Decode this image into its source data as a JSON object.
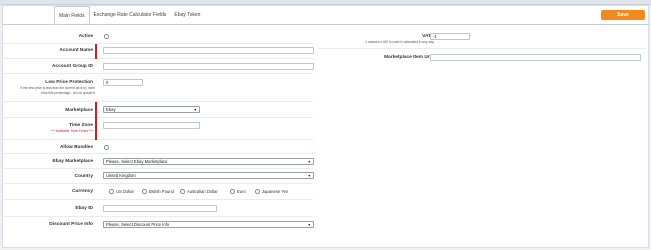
{
  "tabs": [
    {
      "label": "Main Fields",
      "active": true
    },
    {
      "label": "Exchange Rate Calculator Fields",
      "active": false
    },
    {
      "label": "Ebay Token",
      "active": false
    }
  ],
  "save_label": "Save",
  "accent_color": "#f08a1c",
  "required_color": "#d7191c",
  "left": {
    "active_label": "Active",
    "account_name_label": "Account Name",
    "account_name_value": "",
    "account_group_label": "Account Group ID",
    "account_group_value": "",
    "low_price_label": "Low Price Protection",
    "low_price_value": "0",
    "low_price_help_1": "If the new price is less than the current price by more",
    "low_price_help_2": "than this percentage - do not update it",
    "marketplace_label": "Marketplace",
    "marketplace_value": "Ebay",
    "timezone_label": "Time Zone",
    "timezone_link": "*** Available Time Zones ***",
    "timezone_value": "",
    "allow_bundles_label": "Allow Bundles",
    "ebay_marketplace_label": "Ebay Marketplace",
    "ebay_marketplace_value": "Please, Select Ebay Marketplace",
    "country_label": "Country",
    "country_value": "United Kingdom",
    "currency_label": "Currency",
    "currency_options": [
      "US Dollar",
      "British Pound",
      "Australian Dollar",
      "Euro",
      "Japanese Yen"
    ],
    "ebay_id_label": "Ebay ID",
    "ebay_id_value": "",
    "discount_label": "Discount Price Info",
    "discount_value": "Please, Select Discount Price Info"
  },
  "right": {
    "vat_label": "VAT",
    "vat_help": "-1 means no VAT is used in calculated in any way",
    "vat_value": "-1",
    "item_url_label": "Marketplace Item Url",
    "item_url_value": ""
  }
}
